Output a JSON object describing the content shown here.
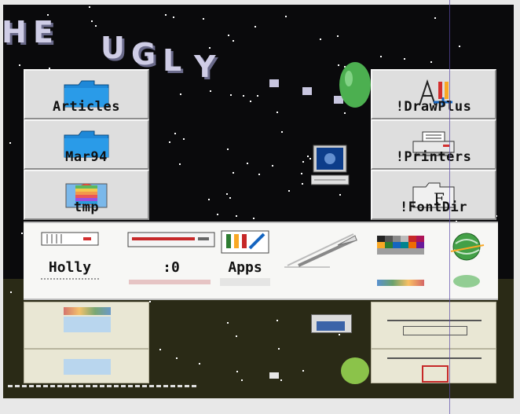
{
  "banner": {
    "letters": [
      "H",
      "E",
      "U",
      "G",
      "L",
      "Y"
    ]
  },
  "left_icons": [
    {
      "label": "Articles",
      "icon": "folder-icon"
    },
    {
      "label": "Mar94",
      "icon": "folder-icon"
    },
    {
      "label": "tmp",
      "icon": "apple-folder-icon"
    }
  ],
  "right_icons": [
    {
      "label": "!DrawPlus",
      "icon": "drawplus-icon"
    },
    {
      "label": "!Printers",
      "icon": "printer-icon"
    },
    {
      "label": "!FontDir",
      "icon": "font-folder-icon"
    }
  ],
  "iconbar": {
    "items": [
      {
        "label": "Holly",
        "icon": "floppy-drive-icon"
      },
      {
        "label": ":0",
        "icon": "hard-drive-icon"
      },
      {
        "label": "Apps",
        "icon": "apps-icon"
      },
      {
        "label": "",
        "icon": "pen-writing-icon"
      },
      {
        "label": "",
        "icon": "palette-icon"
      },
      {
        "label": "",
        "icon": "globe-icon"
      }
    ]
  },
  "colors": {
    "banner": "#cfcde6",
    "folder_blue": "#1e88d8",
    "egg_green": "#4caf50",
    "icon_bg": "#dedede",
    "iconbar_bg": "#f7f7f5"
  }
}
